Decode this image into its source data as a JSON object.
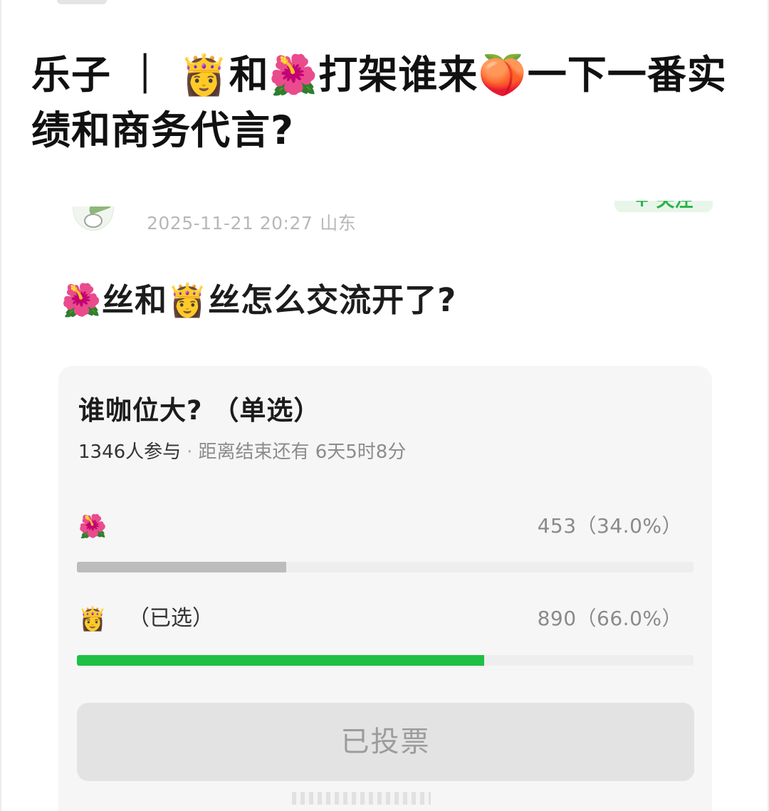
{
  "headline": {
    "part1": "乐子 ｜ ",
    "emoji_princess": "👸",
    "part2": "和",
    "emoji_hibiscus": "🌺",
    "part3": "打架谁来",
    "emoji_peach": "🍑",
    "part4": "一下一番实绩和商务代言?"
  },
  "post": {
    "timestamp": "2025-11-21 20:27",
    "location": "山东",
    "follow_label": "+ 关注",
    "text": {
      "emoji_hibiscus": "🌺",
      "part1": "丝和",
      "emoji_princess": "👸",
      "part2": "丝怎么交流开了?"
    }
  },
  "poll": {
    "title": "谁咖位大? （单选）",
    "participants": "1346人参与",
    "separator": "·",
    "countdown": "距离结束还有 6天5时8分",
    "options": [
      {
        "emoji": "🌺",
        "tag": "",
        "result": "453（34.0%）",
        "votes": 453,
        "percent": 34.0,
        "selected": false,
        "bar_color": "#bcbcbc"
      },
      {
        "emoji": "👸",
        "tag": "（已选）",
        "result": "890（66.0%）",
        "votes": 890,
        "percent": 66.0,
        "selected": true,
        "bar_color": "#1ec045"
      }
    ],
    "voted_button_label": "已投票"
  },
  "colors": {
    "accent_green": "#1ec045",
    "unselected_bar": "#bcbcbc",
    "button_bg": "#e3e3e3"
  }
}
